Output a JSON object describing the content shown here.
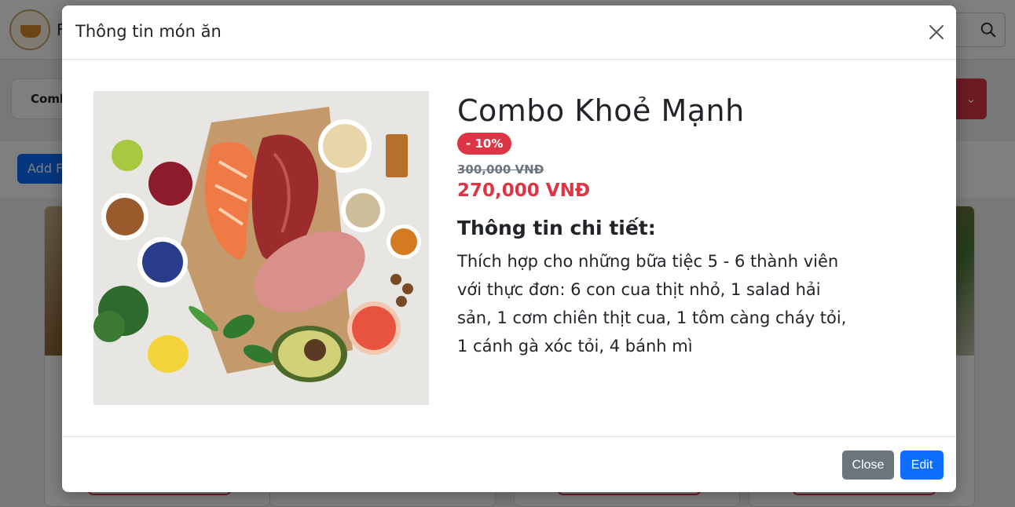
{
  "background": {
    "brand_initial": "F",
    "filter_label": "Combo",
    "add_food_label": "Add Fo"
  },
  "modal": {
    "title": "Thông tin món ăn",
    "close_icon": "close-icon",
    "food": {
      "name": "Combo Khoẻ Mạnh",
      "discount_badge": "- 10%",
      "old_price": "300,000 VNĐ",
      "new_price": "270,000 VNĐ",
      "detail_heading": "Thông tin chi tiết:",
      "detail_text": "Thích hợp cho những bữa tiệc 5 - 6 thành viên với thực đơn: 6 con cua thịt nhỏ, 1 salad hải sản, 1 cơm chiên thịt cua, 1 tôm càng cháy tỏi, 1 cánh gà xóc tỏi, 4 bánh mì"
    },
    "footer": {
      "close_label": "Close",
      "edit_label": "Edit"
    }
  },
  "colors": {
    "danger": "#dc3545",
    "primary": "#0d6efd",
    "secondary": "#6c757d"
  }
}
